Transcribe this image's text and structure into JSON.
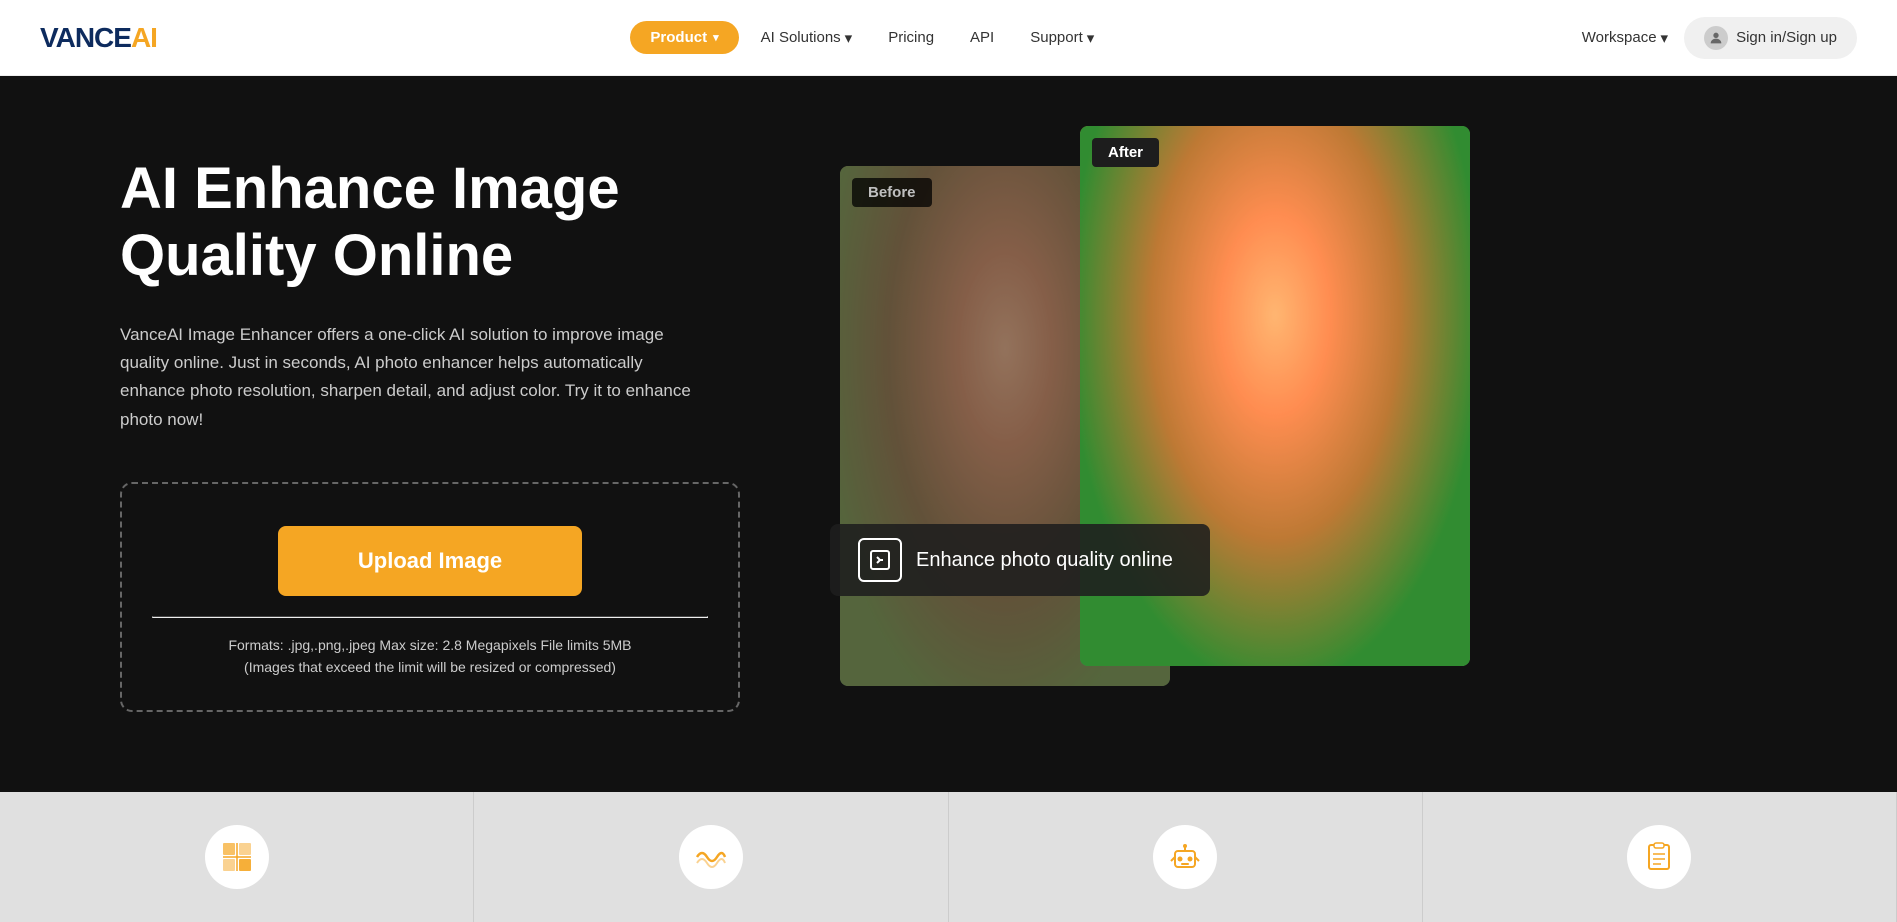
{
  "logo": {
    "text_vance": "VANCE",
    "text_ai": "AI"
  },
  "nav": {
    "product_label": "Product",
    "ai_solutions_label": "AI Solutions",
    "pricing_label": "Pricing",
    "api_label": "API",
    "support_label": "Support",
    "workspace_label": "Workspace",
    "signin_label": "Sign in/Sign up"
  },
  "hero": {
    "title": "AI Enhance Image Quality Online",
    "description": "VanceAI Image Enhancer offers a one-click AI solution to improve image quality online. Just in seconds, AI photo enhancer helps automatically enhance photo resolution, sharpen detail, and adjust color. Try it to enhance photo now!",
    "upload_button": "Upload Image",
    "formats_text": "Formats: .jpg,.png,.jpeg Max size: 2.8 Megapixels File limits 5MB",
    "formats_note": "(Images that exceed the limit will be resized or compressed)"
  },
  "before_label": "Before",
  "after_label": "After",
  "enhance_badge": {
    "text": "Enhance photo quality online"
  },
  "bottom_cards": [
    {
      "icon": "🔲"
    },
    {
      "icon": "〰"
    },
    {
      "icon": "🤖"
    },
    {
      "icon": "📋"
    }
  ]
}
